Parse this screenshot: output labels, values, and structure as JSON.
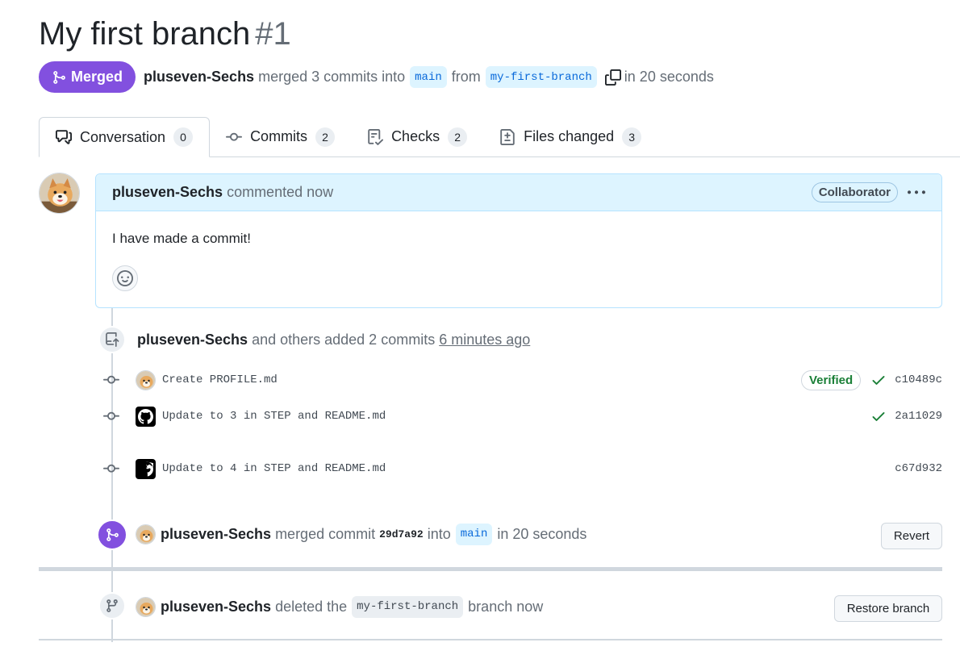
{
  "pr": {
    "title": "My first branch",
    "number": "#1",
    "state": "Merged",
    "author": "pluseven-Sechs",
    "merge_text": "merged 3 commits into",
    "base_branch": "main",
    "from_text": "from",
    "head_branch": "my-first-branch",
    "time_text": "in 20 seconds"
  },
  "tabs": [
    {
      "label": "Conversation",
      "count": "0",
      "icon": "comment-discussion-icon"
    },
    {
      "label": "Commits",
      "count": "2",
      "icon": "git-commit-icon"
    },
    {
      "label": "Checks",
      "count": "2",
      "icon": "checklist-icon"
    },
    {
      "label": "Files changed",
      "count": "3",
      "icon": "file-diff-icon"
    }
  ],
  "comment": {
    "author": "pluseven-Sechs",
    "action": "commented now",
    "role": "Collaborator",
    "body": "I have made a commit!"
  },
  "commits_event": {
    "author": "pluseven-Sechs",
    "text": "and others added 2 commits",
    "time": "6 minutes ago"
  },
  "commits": [
    {
      "message": "Create PROFILE.md",
      "verified": "Verified",
      "status": "check",
      "sha": "c10489c",
      "avatar": "dog-avatar"
    },
    {
      "message": "Update to 3 in STEP and README.md",
      "verified": "",
      "status": "check",
      "sha": "2a11029",
      "avatar": "github-avatar"
    },
    {
      "message": "Update to 4 in STEP and README.md",
      "verified": "",
      "status": "",
      "sha": "c67d932",
      "avatar": "github-avatar"
    }
  ],
  "merge_event": {
    "author": "pluseven-Sechs",
    "text": "merged commit",
    "sha": "29d7a92",
    "into": "into",
    "branch": "main",
    "time": "in 20 seconds",
    "button": "Revert"
  },
  "delete_event": {
    "author": "pluseven-Sechs",
    "text": "deleted the",
    "branch": "my-first-branch",
    "suffix": "branch now",
    "button": "Restore branch"
  },
  "colors": {
    "merged": "#8250df",
    "accent_bg": "#ddf4ff",
    "success": "#1a7f37"
  }
}
